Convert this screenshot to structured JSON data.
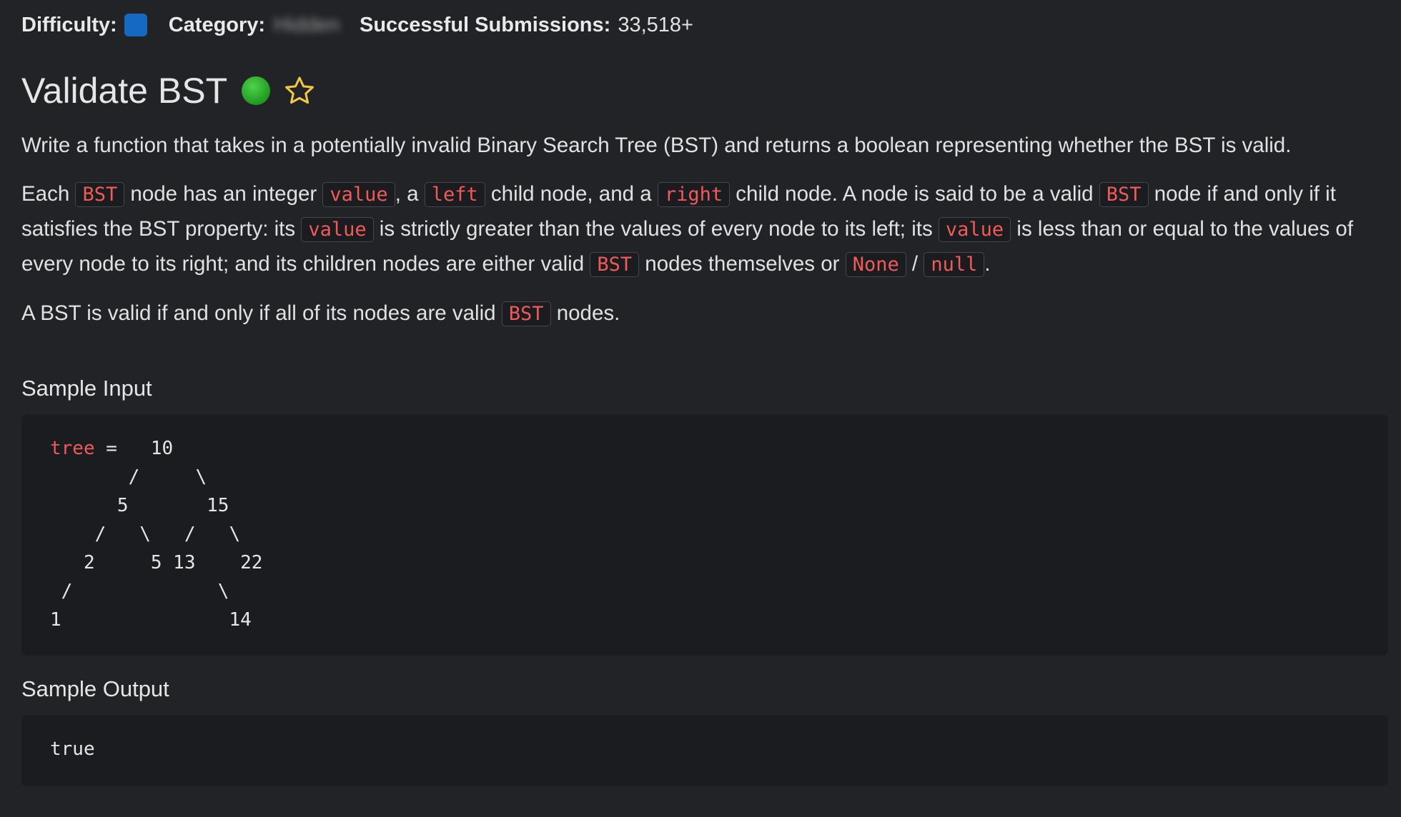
{
  "meta": {
    "difficulty_label": "Difficulty:",
    "difficulty_color": "#1469c0",
    "category_label": "Category:",
    "category_value": "Hidden",
    "submissions_label": "Successful Submissions:",
    "submissions_value": "33,518+"
  },
  "problem": {
    "title": "Validate BST",
    "status_color": "#2fb52a",
    "favorite_icon": "star-outline",
    "star_color": "#f2c744"
  },
  "description": {
    "p1": "Write a function that takes in a potentially invalid Binary Search Tree (BST) and returns a boolean representing whether the BST is valid.",
    "p2": {
      "t1": "Each ",
      "c1": "BST",
      "t2": " node has an integer ",
      "c2": "value",
      "t3": ", a ",
      "c3": "left",
      "t4": " child node, and a ",
      "c4": "right",
      "t5": " child node. A node is said to be a valid ",
      "c5": "BST",
      "t6": " node if and only if it satisfies the BST property: its ",
      "c6": "value",
      "t7": " is strictly greater than the values of every node to its left; its ",
      "c7": "value",
      "t8": " is less than or equal to the values of every node to its right; and its children nodes are either valid ",
      "c8": "BST",
      "t9": " nodes themselves or ",
      "c9": "None",
      "t10": " / ",
      "c10": "null",
      "t11": "."
    },
    "p3": {
      "t1": "A BST is valid if and only if all of its nodes are valid ",
      "c1": "BST",
      "t2": " nodes."
    }
  },
  "sample_input": {
    "heading": "Sample Input",
    "var_name": "tree",
    "tree_text": " =   10\n       /     \\\n      5       15\n    /   \\   /   \\\n   2     5 13    22\n /             \\\n1               14"
  },
  "sample_output": {
    "heading": "Sample Output",
    "value": "true"
  }
}
